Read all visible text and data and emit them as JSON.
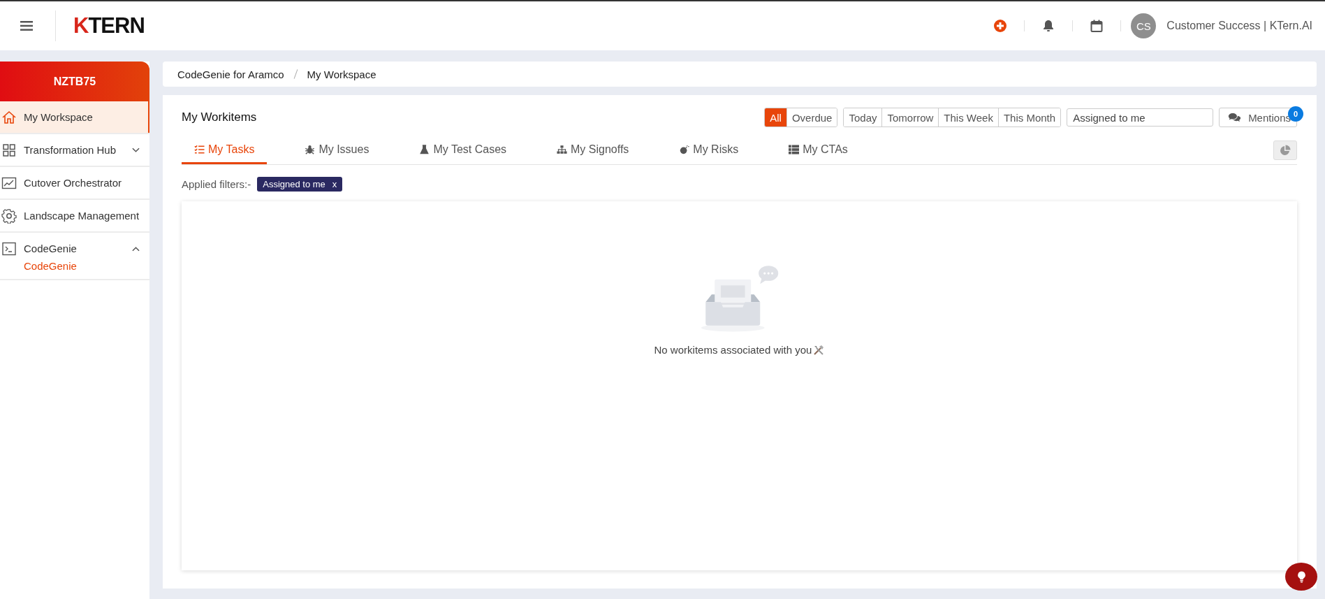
{
  "header": {
    "logo": "KTERN",
    "avatar_initials": "CS",
    "user": "Customer Success | KTern.AI"
  },
  "sidebar": {
    "project": "NZTB75",
    "items": [
      {
        "label": "My Workspace",
        "selected": true
      },
      {
        "label": "Transformation Hub",
        "selected": false,
        "expanded": false
      },
      {
        "label": "Cutover Orchestrator",
        "selected": false
      },
      {
        "label": "Landscape Management",
        "selected": false
      },
      {
        "label": "CodeGenie",
        "selected": false,
        "expanded": true,
        "children": [
          {
            "label": "CodeGenie",
            "selected": true
          }
        ]
      }
    ]
  },
  "breadcrumb": [
    "CodeGenie for Aramco",
    "My Workspace"
  ],
  "workitems": {
    "title": "My Workitems",
    "status_filters": [
      {
        "label": "All",
        "selected": true
      },
      {
        "label": "Overdue",
        "selected": false
      }
    ],
    "date_filters": [
      {
        "label": "Today",
        "selected": false
      },
      {
        "label": "Tomorrow",
        "selected": false
      },
      {
        "label": "This Week",
        "selected": false
      },
      {
        "label": "This Month",
        "selected": false
      }
    ],
    "assignee_select": {
      "value": "Assigned to me"
    },
    "mentions": {
      "label": "Mentions",
      "count": "0"
    },
    "tabs": [
      {
        "label": "My Tasks",
        "selected": true
      },
      {
        "label": "My Issues",
        "selected": false
      },
      {
        "label": "My Test Cases",
        "selected": false
      },
      {
        "label": "My Signoffs",
        "selected": false
      },
      {
        "label": "My Risks",
        "selected": false
      },
      {
        "label": "My CTAs",
        "selected": false
      }
    ],
    "applied_filters_label": "Applied filters:-",
    "applied_filters": [
      "Assigned to me"
    ],
    "remove_filter_glyph": "x",
    "empty_message": "No workitems associated with you"
  }
}
